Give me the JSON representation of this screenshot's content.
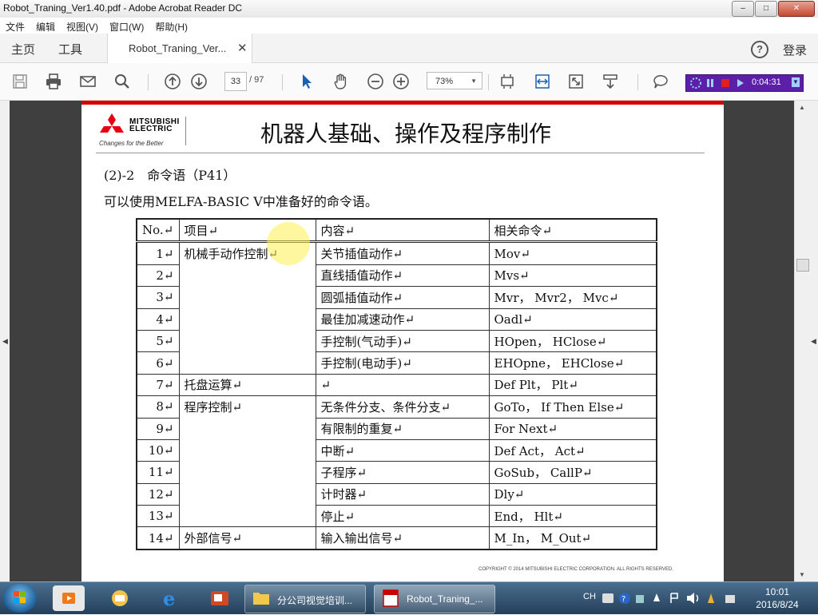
{
  "window": {
    "title": "Robot_Traning_Ver1.40.pdf - Adobe Acrobat Reader DC",
    "min": "–",
    "max": "□",
    "close": "✕"
  },
  "menu": [
    "文件",
    "编辑",
    "视图(V)",
    "窗口(W)",
    "帮助(H)"
  ],
  "tabs": {
    "home": "主页",
    "tools": "工具",
    "document": "Robot_Traning_Ver...",
    "close": "✕",
    "help": "?",
    "signin": "登录"
  },
  "toolbar": {
    "page_current": "33",
    "page_total": "/ 97",
    "zoom": "73%",
    "zoom_arrow": "▼"
  },
  "recorder": {
    "time": "0:04:31"
  },
  "page": {
    "brand": [
      "MITSUBISHI",
      "ELECTRIC"
    ],
    "slogan": "Changes for the Better",
    "title": "机器人基础、操作及程序制作",
    "section": "(2)-2　命令语（P41）",
    "intro": "可以使用MELFA-BASIC Ⅴ中准备好的命令语。",
    "copyright": "COPYRIGHT © 2014 MITSUBISHI ELECTRIC CORPORATION. ALL RIGHTS RESERVED."
  },
  "table": {
    "headers": [
      "No.↵",
      "项目↵",
      "内容↵",
      "相关命令↵"
    ],
    "rows": [
      {
        "no": "1↵",
        "content": "关节插值动作↵",
        "cmd": "Mov↵"
      },
      {
        "no": "2↵",
        "content": "直线插值动作↵",
        "cmd": "Mvs↵"
      },
      {
        "no": "3↵",
        "content": "圆弧插值动作↵",
        "cmd": "Mvr， Mvr2， Mvc↵"
      },
      {
        "no": "4↵",
        "content": "最佳加减速动作↵",
        "cmd": "Oadl↵"
      },
      {
        "no": "5↵",
        "content": "手控制(气动手)↵",
        "cmd": "HOpen， HClose↵"
      },
      {
        "no": "6↵",
        "content": "手控制(电动手)↵",
        "cmd": "EHOpne， EHClose↵"
      },
      {
        "no": "7↵",
        "content": "↵",
        "cmd": "Def Plt， Plt↵"
      },
      {
        "no": "8↵",
        "content": "无条件分支、条件分支↵",
        "cmd": "GoTo， If Then Else↵"
      },
      {
        "no": "9↵",
        "content": "有限制的重复↵",
        "cmd": "For Next↵"
      },
      {
        "no": "10↵",
        "content": "中断↵",
        "cmd": "Def Act， Act↵"
      },
      {
        "no": "11↵",
        "content": "子程序↵",
        "cmd": "GoSub， CallP↵"
      },
      {
        "no": "12↵",
        "content": "计时器↵",
        "cmd": "Dly↵"
      },
      {
        "no": "13↵",
        "content": "停止↵",
        "cmd": "End， Hlt↵"
      },
      {
        "no": "14↵",
        "content": "输入输出信号↵",
        "cmd": "M_In， M_Out↵"
      }
    ],
    "categories": {
      "manual": "机械手动作控制↵",
      "pallet": "托盘运算↵",
      "program": "程序控制↵",
      "external": "外部信号↵"
    }
  },
  "taskbar": {
    "tasks": [
      "分公司视觉培训...",
      "Robot_Traning_..."
    ],
    "lang": "CH",
    "time": "10:01",
    "date": "2016/8/24"
  }
}
